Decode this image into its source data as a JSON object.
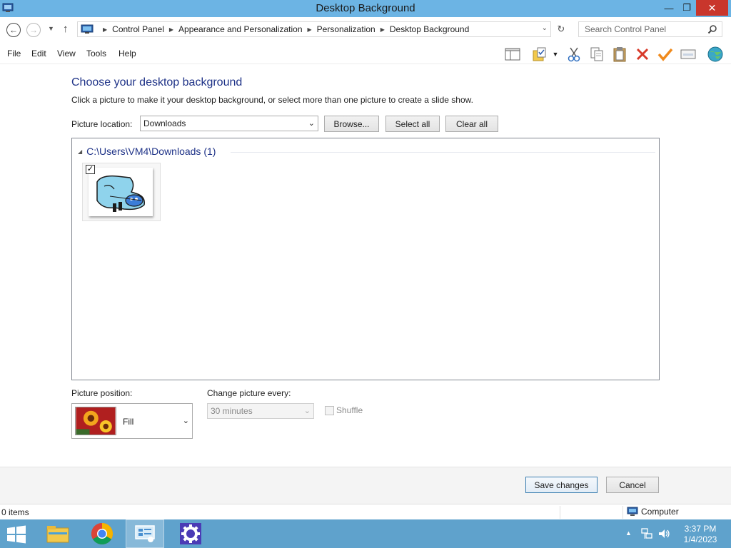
{
  "window": {
    "title": "Desktop Background",
    "minimize_glyph": "—",
    "maximize_glyph": "❐",
    "close_glyph": "✕"
  },
  "address": {
    "breadcrumbs": [
      "Control Panel",
      "Appearance and Personalization",
      "Personalization",
      "Desktop Background"
    ],
    "search_placeholder": "Search Control Panel"
  },
  "menu": [
    "File",
    "Edit",
    "View",
    "Tools",
    "Help"
  ],
  "toolbar_icons": [
    "layout-pane-icon",
    "folder-options-icon",
    "cut-icon",
    "copy-icon",
    "paste-icon",
    "delete-icon",
    "check-icon",
    "properties-icon",
    "globe-icon"
  ],
  "content": {
    "title": "Choose your desktop background",
    "description": "Click a picture to make it your desktop background, or select more than one picture to create a slide show.",
    "picture_location_label": "Picture location:",
    "picture_location_value": "Downloads",
    "browse_label": "Browse...",
    "select_all_label": "Select all",
    "clear_all_label": "Clear all"
  },
  "gallery": {
    "group_label": "C:\\Users\\VM4\\Downloads (1)",
    "items": [
      {
        "checked": true
      }
    ]
  },
  "position": {
    "label": "Picture position:",
    "value": "Fill"
  },
  "interval": {
    "label": "Change picture every:",
    "value": "30 minutes",
    "enabled": false
  },
  "shuffle": {
    "label": "Shuffle",
    "checked": false,
    "enabled": false
  },
  "footer": {
    "save_label": "Save changes",
    "cancel_label": "Cancel"
  },
  "status": {
    "items": "0 items",
    "location": "Computer"
  },
  "taskbar": {
    "apps": [
      "file-explorer-icon",
      "chrome-icon",
      "control-panel-icon",
      "settings-icon"
    ],
    "time": "3:37 PM",
    "date": "1/4/2023"
  },
  "colors": {
    "titlebar": "#6cb4e4",
    "heading": "#1e3287",
    "close_button": "#c9362c",
    "taskbar": "#5fa2cc"
  }
}
